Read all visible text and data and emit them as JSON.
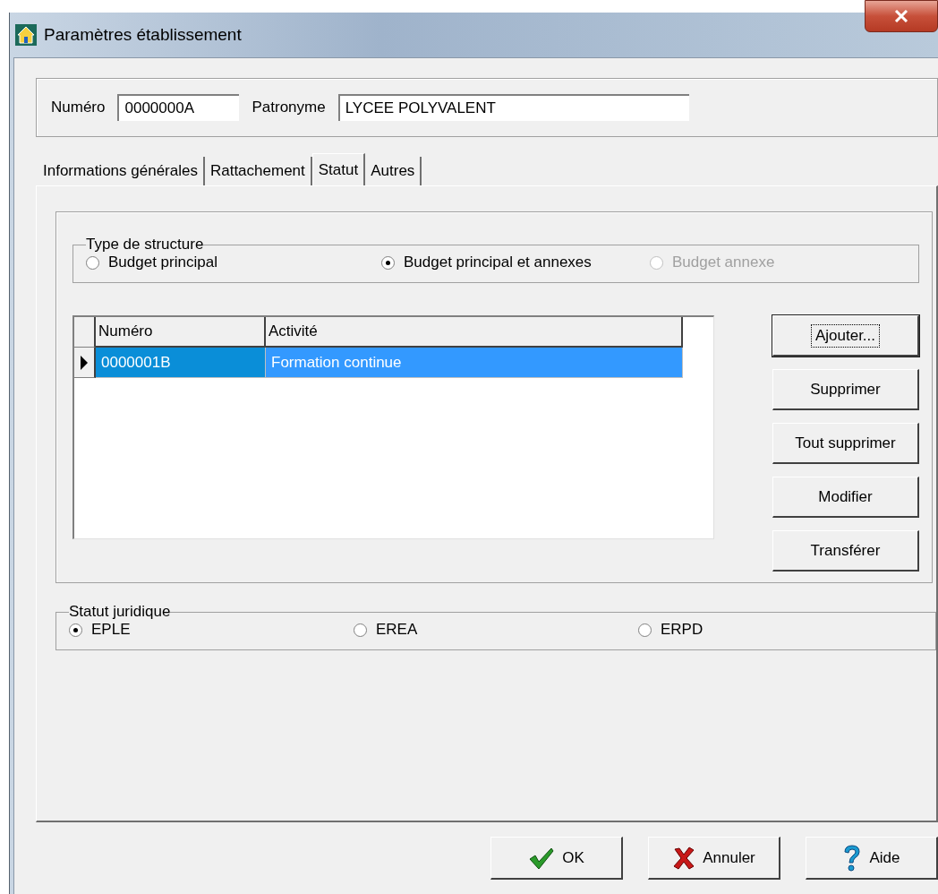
{
  "window": {
    "title": "Paramètres établissement"
  },
  "header": {
    "numero_label": "Numéro",
    "numero_value": "0000000A",
    "patronyme_label": "Patronyme",
    "patronyme_value": "LYCEE POLYVALENT"
  },
  "tabs": [
    {
      "label": "Informations générales",
      "selected": false
    },
    {
      "label": "Rattachement",
      "selected": false
    },
    {
      "label": "Statut",
      "selected": true
    },
    {
      "label": "Autres",
      "selected": false
    }
  ],
  "type_de_structure": {
    "title": "Type de structure",
    "options": [
      {
        "label": "Budget principal",
        "selected": false,
        "disabled": false
      },
      {
        "label": "Budget principal et annexes",
        "selected": true,
        "disabled": false
      },
      {
        "label": "Budget annexe",
        "selected": false,
        "disabled": true
      }
    ]
  },
  "table": {
    "columns": [
      "Numéro",
      "Activité"
    ],
    "rows": [
      {
        "cells": [
          "0000001B",
          "Formation continue"
        ],
        "selected": true
      }
    ]
  },
  "side_buttons": [
    {
      "label": "Ajouter...",
      "focused": true
    },
    {
      "label": "Supprimer",
      "focused": false
    },
    {
      "label": "Tout supprimer",
      "focused": false
    },
    {
      "label": "Modifier",
      "focused": false
    },
    {
      "label": "Transférer",
      "focused": false
    }
  ],
  "statut_juridique": {
    "title": "Statut juridique",
    "options": [
      {
        "label": "EPLE",
        "selected": true
      },
      {
        "label": "EREA",
        "selected": false
      },
      {
        "label": "ERPD",
        "selected": false
      }
    ]
  },
  "buttons": [
    {
      "kind": "ok",
      "label": "OK"
    },
    {
      "kind": "cancel",
      "label": "Annuler"
    },
    {
      "kind": "help",
      "label": "Aide"
    }
  ]
}
